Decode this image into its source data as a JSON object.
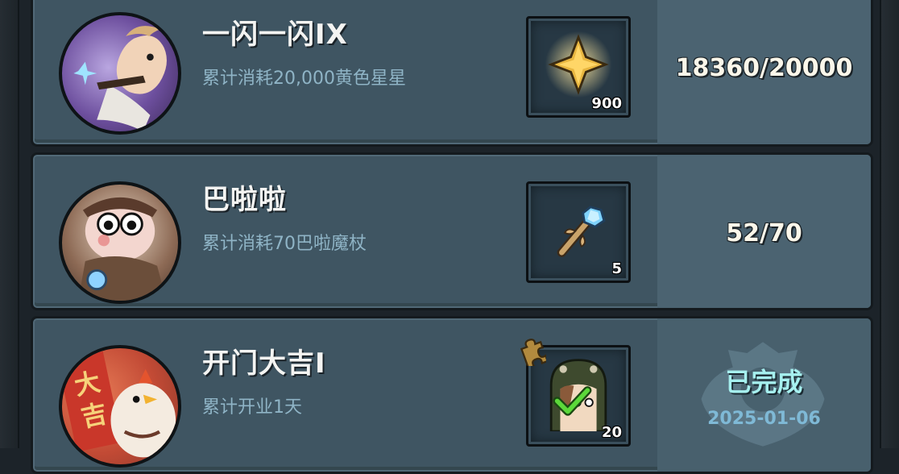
{
  "achievements": [
    {
      "title": "一闪一闪IX",
      "description": "累计消耗20,000黄色星星",
      "reward": {
        "icon": "gold-star-icon",
        "count": "900"
      },
      "progress": "18360/20000"
    },
    {
      "title": "巴啦啦",
      "description": "累计消耗70巴啦魔杖",
      "reward": {
        "icon": "magic-wand-icon",
        "count": "5"
      },
      "progress": "52/70"
    },
    {
      "title": "开门大吉I",
      "description": "累计开业1天",
      "reward": {
        "icon": "dino-hood-avatar-icon",
        "count": "20"
      },
      "status": "已完成",
      "date": "2025-01-06",
      "avatar_badge_text": [
        "大",
        "吉"
      ]
    }
  ]
}
